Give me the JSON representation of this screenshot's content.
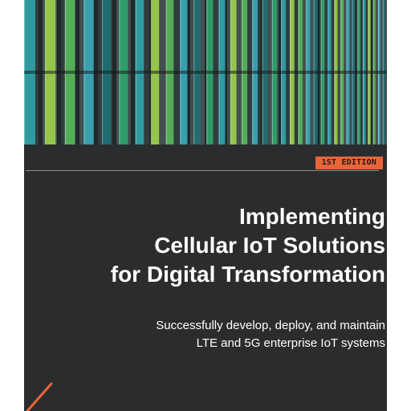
{
  "cover": {
    "edition": "1ST EDITION",
    "title_lines": [
      "Implementing",
      "Cellular IoT Solutions",
      "for Digital Transformation"
    ],
    "subtitle_lines": [
      "Successfully develop, deploy, and maintain",
      "LTE and 5G enterprise IoT systems"
    ]
  },
  "colors": {
    "background": "#2b2c2e",
    "accent": "#e8653a",
    "text": "#ffffff",
    "glass_green": "#2fa36b",
    "glass_teal": "#2fa3a8",
    "glass_lime": "#9ccf4a"
  },
  "image": {
    "subject": "building facade with colored glass fins"
  }
}
